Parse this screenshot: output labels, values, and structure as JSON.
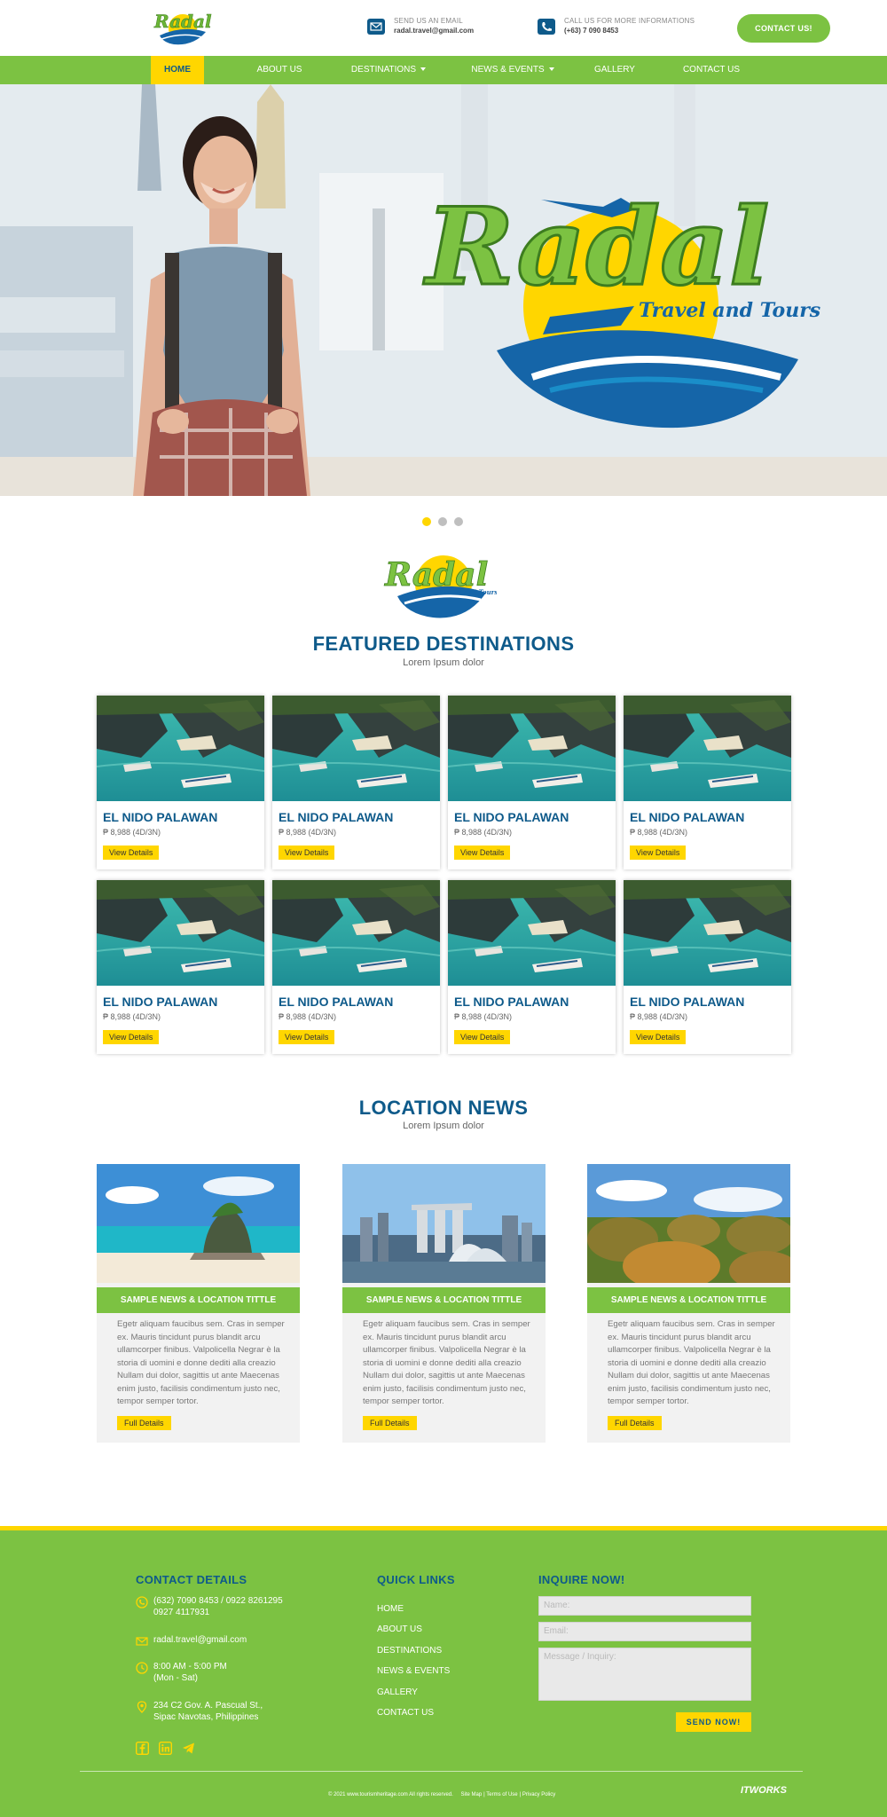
{
  "header": {
    "email_label": "SEND US AN EMAIL",
    "email_value": "radal.travel@gmail.com",
    "phone_label": "CALL US FOR MORE INFORMATIONS",
    "phone_value": "(+63) 7 090 8453",
    "contact_button": "CONTACT US!"
  },
  "nav": {
    "items": [
      {
        "label": "HOME"
      },
      {
        "label": "ABOUT US"
      },
      {
        "label": "DESTINATIONS"
      },
      {
        "label": "NEWS & EVENTS"
      },
      {
        "label": "GALLERY"
      },
      {
        "label": "CONTACT US"
      }
    ]
  },
  "brand": {
    "name": "Radal",
    "tagline": "Travel and Tours"
  },
  "slider": {
    "dots": 3,
    "active": 1
  },
  "featured": {
    "title": "FEATURED DESTINATIONS",
    "subtitle": "Lorem Ipsum dolor",
    "cards": [
      {
        "title": "EL NIDO PALAWAN",
        "price": "₱ 8,988 (4D/3N)",
        "button": "View Details"
      },
      {
        "title": "EL NIDO PALAWAN",
        "price": "₱ 8,988 (4D/3N)",
        "button": "View Details"
      },
      {
        "title": "EL NIDO PALAWAN",
        "price": "₱ 8,988 (4D/3N)",
        "button": "View Details"
      },
      {
        "title": "EL NIDO PALAWAN",
        "price": "₱ 8,988 (4D/3N)",
        "button": "View Details"
      },
      {
        "title": "EL NIDO PALAWAN",
        "price": "₱ 8,988 (4D/3N)",
        "button": "View Details"
      },
      {
        "title": "EL NIDO PALAWAN",
        "price": "₱ 8,988 (4D/3N)",
        "button": "View Details"
      },
      {
        "title": "EL NIDO PALAWAN",
        "price": "₱ 8,988 (4D/3N)",
        "button": "View Details"
      },
      {
        "title": "EL NIDO PALAWAN",
        "price": "₱ 8,988 (4D/3N)",
        "button": "View Details"
      }
    ]
  },
  "news": {
    "title": "LOCATION NEWS",
    "subtitle": "Lorem Ipsum dolor",
    "items": [
      {
        "title": "SAMPLE NEWS & LOCATION TITTLE",
        "text": "Egetr aliquam faucibus sem. Cras in semper ex. Mauris tincidunt purus blandit arcu ullamcorper finibus. Valpolicella Negrar è la storia di uomini e donne dediti alla creazio Nullam dui dolor, sagittis ut ante  Maecenas enim justo, facilisis condimentum justo nec, tempor semper tortor.",
        "button": "Full Details"
      },
      {
        "title": "SAMPLE NEWS & LOCATION TITTLE",
        "text": "Egetr aliquam faucibus sem. Cras in semper ex. Mauris tincidunt purus blandit arcu ullamcorper finibus. Valpolicella Negrar è la storia di uomini e donne dediti alla creazio Nullam dui dolor, sagittis ut ante  Maecenas enim justo, facilisis condimentum justo nec, tempor semper tortor.",
        "button": "Full Details"
      },
      {
        "title": "SAMPLE NEWS & LOCATION TITTLE",
        "text": "Egetr aliquam faucibus sem. Cras in semper ex. Mauris tincidunt purus blandit arcu ullamcorper finibus. Valpolicella Negrar è la storia di uomini e donne dediti alla creazio Nullam dui dolor, sagittis ut ante  Maecenas enim justo, facilisis condimentum justo nec, tempor semper tortor.",
        "button": "Full Details"
      }
    ]
  },
  "footer": {
    "contact_title": "CONTACT DETAILS",
    "phone_line1": "(632) 7090 8453 / 0922 8261295",
    "phone_line2": "0927 4117931",
    "email": "radal.travel@gmail.com",
    "hours_line1": "8:00 AM - 5:00 PM",
    "hours_line2": "(Mon - Sat)",
    "address_line1": "234 C2 Gov. A. Pascual St.,",
    "address_line2": "Sipac Navotas, Philippines",
    "links_title": "QUICK LINKS",
    "links": [
      "HOME",
      "ABOUT US",
      "DESTINATIONS",
      "NEWS & EVENTS",
      "GALLERY",
      "CONTACT US"
    ],
    "inquire_title": "INQUIRE NOW!",
    "name_placeholder": "Name:",
    "email_placeholder": "Email:",
    "message_placeholder": "Message / Inquiry:",
    "send_button": "SEND NOW!",
    "copyright": "© 2021 www.tourismheritage.com  All rights reserved.",
    "legal_links": [
      "Site Map",
      "Terms of Use",
      "Privacy Policy"
    ],
    "developer": "ITWORKS"
  },
  "colors": {
    "green": "#7cc242",
    "yellow": "#ffd600",
    "blue": "#0e5a8a"
  }
}
